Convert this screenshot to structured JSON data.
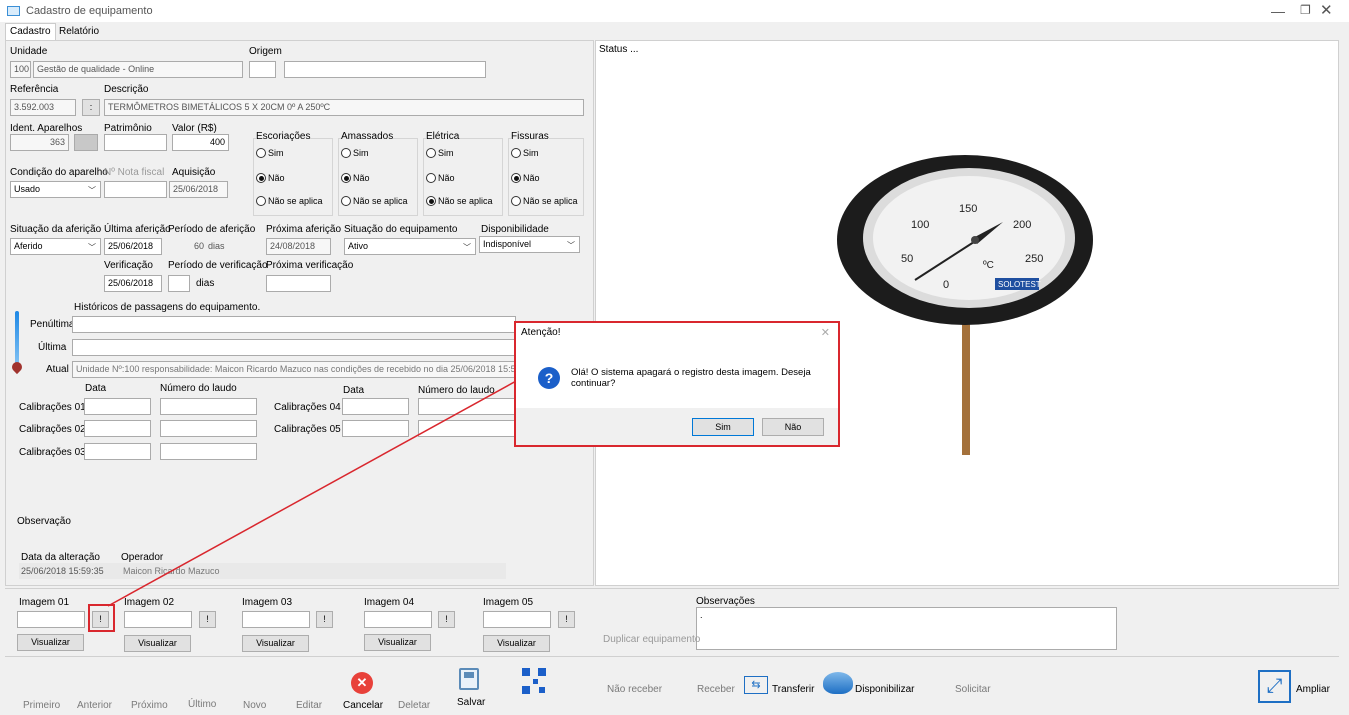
{
  "window": {
    "title": "Cadastro de equipamento"
  },
  "tabs": [
    {
      "label": "Cadastro"
    },
    {
      "label": "Relatório"
    }
  ],
  "form": {
    "unidade_label": "Unidade",
    "unidade_code": "100",
    "unidade_name": "Gestão de qualidade - Online",
    "origem_label": "Origem",
    "referencia_label": "Referência",
    "referencia_value": "3.592.003",
    "ref_button": ":",
    "descricao_label": "Descrição",
    "descricao_value": "TERMÔMETROS BIMETÁLICOS 5 X 20CM 0º A 250ºC",
    "ident_label": "Ident. Aparelhos",
    "ident_value": "363",
    "patrimonio_label": "Patrimônio",
    "valor_label": "Valor (R$)",
    "valor_value": "400",
    "condicao_label": "Condição do aparelho",
    "nota_fiscal_label": "Nº Nota fiscal",
    "aquisicao_label": "Aquisição",
    "condicao_value": "Usado",
    "aquisicao_value": "25/06/2018",
    "checks": [
      {
        "title": "Escoriações",
        "opts": [
          "Sim",
          "Não",
          "Não se aplica"
        ]
      },
      {
        "title": "Amassados",
        "opts": [
          "Sim",
          "Não",
          "Não se aplica"
        ]
      },
      {
        "title": "Elétrica",
        "opts": [
          "Sim",
          "Não",
          "Não se aplica"
        ]
      },
      {
        "title": "Fissuras",
        "opts": [
          "Sim",
          "Não",
          "Não se aplica"
        ]
      }
    ],
    "situacao_label": "Situação da aferição",
    "situacao_value": "Aferido",
    "ultima_label": "Última aferição",
    "ultima_value": "25/06/2018",
    "periodo_label": "Período de aferição",
    "periodo_value": "60",
    "dias": "dias",
    "proxima_label": "Próxima aferição",
    "proxima_value": "24/08/2018",
    "sit_equip_label": "Situação do equipamento",
    "sit_equip_value": "Ativo",
    "disp_label": "Disponibilidade",
    "disp_value": "Indisponível",
    "verif_label": "Verificação",
    "verif_value": "25/06/2018",
    "periodo_verif_label": "Período de verificação",
    "prox_verif_label": "Próxima verificação",
    "hist_label": "Históricos de passagens do equipamento.",
    "penultima_label": "Penúltima",
    "ultima_hist_label": "Última",
    "atual_label": "Atual",
    "atual_value": "Unidade Nº:100 responsabilidade: Maicon Ricardo Mazuco nas condições de recebido no dia 25/06/2018 15:59",
    "data_label": "Data",
    "numero_laudo_label": "Número do laudo",
    "calib": [
      "Calibrações 01",
      "Calibrações 02",
      "Calibrações 03",
      "Calibrações 04",
      "Calibrações 05"
    ],
    "observacao_label": "Observação",
    "data_alteracao_label": "Data da alteração",
    "data_alteracao_value": "25/06/2018 15:59:35",
    "operador_label": "Operador",
    "operador_value": "Maicon Ricardo Mazuco"
  },
  "status_text": "Status ...",
  "images": [
    {
      "label": "Imagem 01"
    },
    {
      "label": "Imagem 02"
    },
    {
      "label": "Imagem 03"
    },
    {
      "label": "Imagem 04"
    },
    {
      "label": "Imagem 05"
    }
  ],
  "image_btn": "!",
  "visualizar": "Visualizar",
  "observacoes_label": "Observações",
  "observacoes_value": ".",
  "duplicar_label": "Duplicar equipamento",
  "toolbar": {
    "primeiro": "Primeiro",
    "anterior": "Anterior",
    "proximo": "Próximo",
    "ultimo": "Último",
    "novo": "Novo",
    "editar": "Editar",
    "cancelar": "Cancelar",
    "deletar": "Deletar",
    "salvar": "Salvar",
    "nao_receber": "Não receber",
    "receber": "Receber",
    "transferir": "Transferir",
    "disponibilizar": "Disponibilizar",
    "solicitar": "Solicitar",
    "ampliar": "Ampliar"
  },
  "dialog": {
    "title": "Atenção!",
    "message": "Olá! O sistema apagará o registro desta imagem. Deseja continuar?",
    "yes": "Sim",
    "no": "Não"
  },
  "gauge": {
    "ticks": [
      "0",
      "50",
      "100",
      "150",
      "200",
      "250"
    ],
    "unit": "ºC",
    "brand": "SOLOTEST"
  },
  "colors": {
    "highlight": "#d9272e",
    "accent": "#1e6fc4",
    "info_blue": "#1b5fc9"
  }
}
